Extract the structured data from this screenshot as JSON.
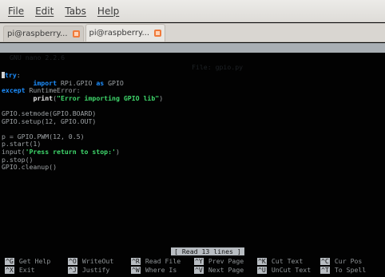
{
  "menubar": {
    "items": [
      "File",
      "Edit",
      "Tabs",
      "Help"
    ]
  },
  "tabs": [
    {
      "label": "pi@raspberry...",
      "active": false
    },
    {
      "label": "pi@raspberry...",
      "active": true
    }
  ],
  "nano": {
    "version": "GNU nano 2.2.6",
    "file": "File: gpio.py"
  },
  "code_lines": [
    {
      "segments": [
        {
          "t": "try",
          "c": "kw"
        },
        {
          "t": ":",
          "c": "plain"
        }
      ]
    },
    {
      "segments": [
        {
          "t": "        ",
          "c": "plain"
        },
        {
          "t": "import",
          "c": "kw"
        },
        {
          "t": " RPi.GPIO ",
          "c": "plain"
        },
        {
          "t": "as",
          "c": "kw"
        },
        {
          "t": " GPIO",
          "c": "plain"
        }
      ]
    },
    {
      "segments": [
        {
          "t": "except",
          "c": "kw"
        },
        {
          "t": " RuntimeError:",
          "c": "plain"
        }
      ]
    },
    {
      "segments": [
        {
          "t": "        ",
          "c": "plain"
        },
        {
          "t": "print",
          "c": "fn"
        },
        {
          "t": "(",
          "c": "plain"
        },
        {
          "t": "\"Error importing GPIO lib\"",
          "c": "str"
        },
        {
          "t": ")",
          "c": "plain"
        }
      ]
    },
    {
      "segments": []
    },
    {
      "segments": [
        {
          "t": "GPIO.setmode(GPIO.BOARD)",
          "c": "plain"
        }
      ]
    },
    {
      "segments": [
        {
          "t": "GPIO.setup(12, GPIO.OUT)",
          "c": "plain"
        }
      ]
    },
    {
      "segments": []
    },
    {
      "segments": [
        {
          "t": "p = GPIO.PWM(12, 0.5)",
          "c": "plain"
        }
      ]
    },
    {
      "segments": [
        {
          "t": "p.start(1)",
          "c": "plain"
        }
      ]
    },
    {
      "segments": [
        {
          "t": "input(",
          "c": "plain"
        },
        {
          "t": "'Press return to stop:'",
          "c": "str"
        },
        {
          "t": ")",
          "c": "plain"
        }
      ]
    },
    {
      "segments": [
        {
          "t": "p.stop()",
          "c": "plain"
        }
      ]
    },
    {
      "segments": [
        {
          "t": "GPIO.cleanup()",
          "c": "plain"
        }
      ]
    }
  ],
  "status": "[ Read 13 lines ]",
  "shortcuts": [
    [
      {
        "key": "^G",
        "label": "Get Help"
      },
      {
        "key": "^O",
        "label": "WriteOut"
      },
      {
        "key": "^R",
        "label": "Read File"
      },
      {
        "key": "^Y",
        "label": "Prev Page"
      },
      {
        "key": "^K",
        "label": "Cut Text"
      },
      {
        "key": "^C",
        "label": "Cur Pos"
      }
    ],
    [
      {
        "key": "^X",
        "label": "Exit"
      },
      {
        "key": "^J",
        "label": "Justify"
      },
      {
        "key": "^W",
        "label": "Where Is"
      },
      {
        "key": "^V",
        "label": "Next Page"
      },
      {
        "key": "^U",
        "label": "UnCut Text"
      },
      {
        "key": "^T",
        "label": "To Spell"
      }
    ]
  ],
  "colors": {
    "keyword": "#1d8fff",
    "string": "#3fd86c",
    "tab_close": "#f07a3a"
  }
}
